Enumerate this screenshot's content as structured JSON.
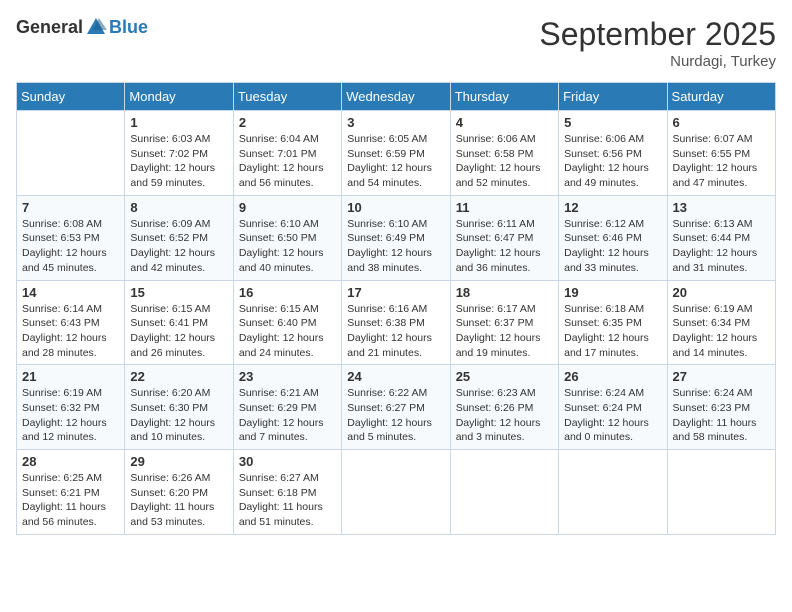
{
  "header": {
    "logo_general": "General",
    "logo_blue": "Blue",
    "month": "September 2025",
    "location": "Nurdagi, Turkey"
  },
  "days_of_week": [
    "Sunday",
    "Monday",
    "Tuesday",
    "Wednesday",
    "Thursday",
    "Friday",
    "Saturday"
  ],
  "weeks": [
    [
      {
        "day": "",
        "info": ""
      },
      {
        "day": "1",
        "info": "Sunrise: 6:03 AM\nSunset: 7:02 PM\nDaylight: 12 hours\nand 59 minutes."
      },
      {
        "day": "2",
        "info": "Sunrise: 6:04 AM\nSunset: 7:01 PM\nDaylight: 12 hours\nand 56 minutes."
      },
      {
        "day": "3",
        "info": "Sunrise: 6:05 AM\nSunset: 6:59 PM\nDaylight: 12 hours\nand 54 minutes."
      },
      {
        "day": "4",
        "info": "Sunrise: 6:06 AM\nSunset: 6:58 PM\nDaylight: 12 hours\nand 52 minutes."
      },
      {
        "day": "5",
        "info": "Sunrise: 6:06 AM\nSunset: 6:56 PM\nDaylight: 12 hours\nand 49 minutes."
      },
      {
        "day": "6",
        "info": "Sunrise: 6:07 AM\nSunset: 6:55 PM\nDaylight: 12 hours\nand 47 minutes."
      }
    ],
    [
      {
        "day": "7",
        "info": "Sunrise: 6:08 AM\nSunset: 6:53 PM\nDaylight: 12 hours\nand 45 minutes."
      },
      {
        "day": "8",
        "info": "Sunrise: 6:09 AM\nSunset: 6:52 PM\nDaylight: 12 hours\nand 42 minutes."
      },
      {
        "day": "9",
        "info": "Sunrise: 6:10 AM\nSunset: 6:50 PM\nDaylight: 12 hours\nand 40 minutes."
      },
      {
        "day": "10",
        "info": "Sunrise: 6:10 AM\nSunset: 6:49 PM\nDaylight: 12 hours\nand 38 minutes."
      },
      {
        "day": "11",
        "info": "Sunrise: 6:11 AM\nSunset: 6:47 PM\nDaylight: 12 hours\nand 36 minutes."
      },
      {
        "day": "12",
        "info": "Sunrise: 6:12 AM\nSunset: 6:46 PM\nDaylight: 12 hours\nand 33 minutes."
      },
      {
        "day": "13",
        "info": "Sunrise: 6:13 AM\nSunset: 6:44 PM\nDaylight: 12 hours\nand 31 minutes."
      }
    ],
    [
      {
        "day": "14",
        "info": "Sunrise: 6:14 AM\nSunset: 6:43 PM\nDaylight: 12 hours\nand 28 minutes."
      },
      {
        "day": "15",
        "info": "Sunrise: 6:15 AM\nSunset: 6:41 PM\nDaylight: 12 hours\nand 26 minutes."
      },
      {
        "day": "16",
        "info": "Sunrise: 6:15 AM\nSunset: 6:40 PM\nDaylight: 12 hours\nand 24 minutes."
      },
      {
        "day": "17",
        "info": "Sunrise: 6:16 AM\nSunset: 6:38 PM\nDaylight: 12 hours\nand 21 minutes."
      },
      {
        "day": "18",
        "info": "Sunrise: 6:17 AM\nSunset: 6:37 PM\nDaylight: 12 hours\nand 19 minutes."
      },
      {
        "day": "19",
        "info": "Sunrise: 6:18 AM\nSunset: 6:35 PM\nDaylight: 12 hours\nand 17 minutes."
      },
      {
        "day": "20",
        "info": "Sunrise: 6:19 AM\nSunset: 6:34 PM\nDaylight: 12 hours\nand 14 minutes."
      }
    ],
    [
      {
        "day": "21",
        "info": "Sunrise: 6:19 AM\nSunset: 6:32 PM\nDaylight: 12 hours\nand 12 minutes."
      },
      {
        "day": "22",
        "info": "Sunrise: 6:20 AM\nSunset: 6:30 PM\nDaylight: 12 hours\nand 10 minutes."
      },
      {
        "day": "23",
        "info": "Sunrise: 6:21 AM\nSunset: 6:29 PM\nDaylight: 12 hours\nand 7 minutes."
      },
      {
        "day": "24",
        "info": "Sunrise: 6:22 AM\nSunset: 6:27 PM\nDaylight: 12 hours\nand 5 minutes."
      },
      {
        "day": "25",
        "info": "Sunrise: 6:23 AM\nSunset: 6:26 PM\nDaylight: 12 hours\nand 3 minutes."
      },
      {
        "day": "26",
        "info": "Sunrise: 6:24 AM\nSunset: 6:24 PM\nDaylight: 12 hours\nand 0 minutes."
      },
      {
        "day": "27",
        "info": "Sunrise: 6:24 AM\nSunset: 6:23 PM\nDaylight: 11 hours\nand 58 minutes."
      }
    ],
    [
      {
        "day": "28",
        "info": "Sunrise: 6:25 AM\nSunset: 6:21 PM\nDaylight: 11 hours\nand 56 minutes."
      },
      {
        "day": "29",
        "info": "Sunrise: 6:26 AM\nSunset: 6:20 PM\nDaylight: 11 hours\nand 53 minutes."
      },
      {
        "day": "30",
        "info": "Sunrise: 6:27 AM\nSunset: 6:18 PM\nDaylight: 11 hours\nand 51 minutes."
      },
      {
        "day": "",
        "info": ""
      },
      {
        "day": "",
        "info": ""
      },
      {
        "day": "",
        "info": ""
      },
      {
        "day": "",
        "info": ""
      }
    ]
  ]
}
